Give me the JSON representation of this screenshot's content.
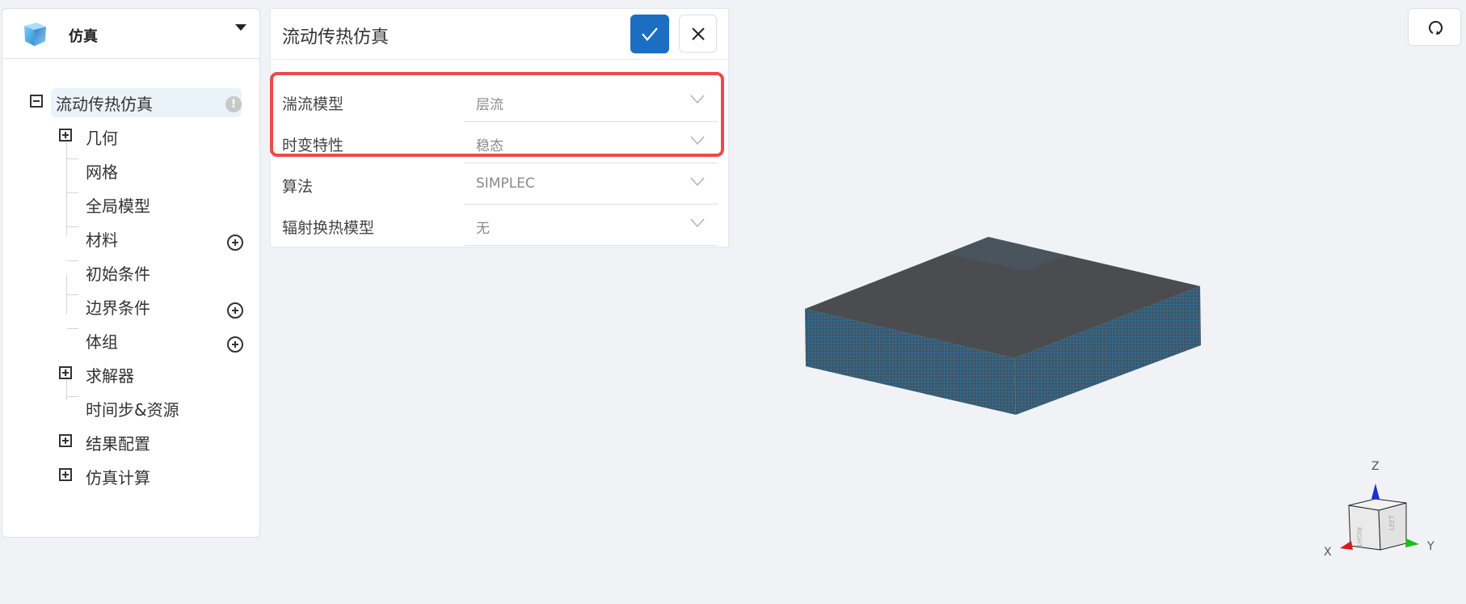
{
  "sidebar": {
    "title": "仿真",
    "logo_icon": "cube-icon",
    "tree": {
      "root": {
        "label": "流动传热仿真",
        "status_icon": "warning-icon"
      },
      "items": [
        {
          "label": "几何",
          "expandable": true,
          "add": false
        },
        {
          "label": "网格",
          "expandable": false,
          "add": false
        },
        {
          "label": "全局模型",
          "expandable": false,
          "add": false
        },
        {
          "label": "材料",
          "expandable": false,
          "add": true
        },
        {
          "label": "初始条件",
          "expandable": false,
          "add": false
        },
        {
          "label": "边界条件",
          "expandable": false,
          "add": true
        },
        {
          "label": "体组",
          "expandable": false,
          "add": true
        },
        {
          "label": "求解器",
          "expandable": true,
          "add": false
        },
        {
          "label": "时间步&资源",
          "expandable": false,
          "add": false
        },
        {
          "label": "结果配置",
          "expandable": true,
          "add": false
        },
        {
          "label": "仿真计算",
          "expandable": true,
          "add": false
        }
      ]
    }
  },
  "panel": {
    "title": "流动传热仿真",
    "confirm_icon": "check-icon",
    "close_icon": "close-icon",
    "fields": [
      {
        "label": "湍流模型",
        "value": "层流"
      },
      {
        "label": "时变特性",
        "value": "稳态"
      },
      {
        "label": "算法",
        "value": "SIMPLEC"
      },
      {
        "label": "辐射换热模型",
        "value": "无"
      }
    ],
    "highlight_color": "#ee4a4a",
    "accent_color": "#1b6ec2"
  },
  "viewport": {
    "reset_icon": "rotate-reset-icon",
    "axes": {
      "x": "X",
      "y": "Y",
      "z": "Z"
    },
    "cube_faces": {
      "right": "RIGHT",
      "left": "LEFT"
    },
    "mesh_colors": {
      "top": "#4a4c4f",
      "side": "#3d5f75",
      "grid": "#1a7fb8"
    }
  }
}
